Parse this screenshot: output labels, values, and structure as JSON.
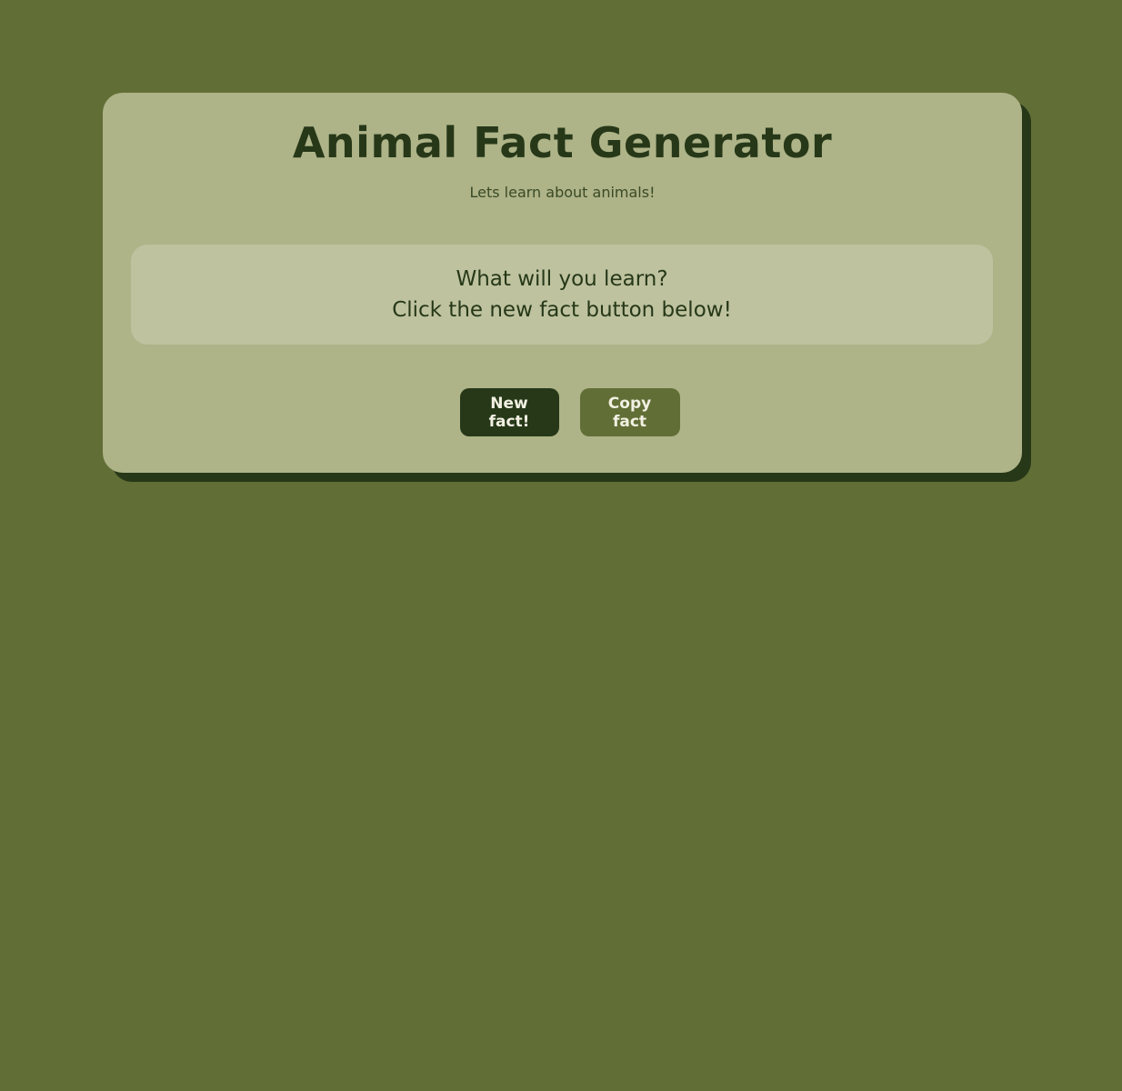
{
  "page": {
    "title": "Animal Fact Generator",
    "subtitle": "Lets learn about animals!"
  },
  "fact": {
    "line1": "What will you learn?",
    "line2": "Click the new fact button below!"
  },
  "buttons": {
    "new_fact_label": "New fact!",
    "copy_fact_label": "Copy fact"
  },
  "colors": {
    "background": "#616e36",
    "card": "#aeb388",
    "card_shadow": "#263818",
    "fact_box": "#bec29f",
    "primary_button": "#263818",
    "secondary_button": "#616e36",
    "button_text": "#f1f0e2"
  }
}
